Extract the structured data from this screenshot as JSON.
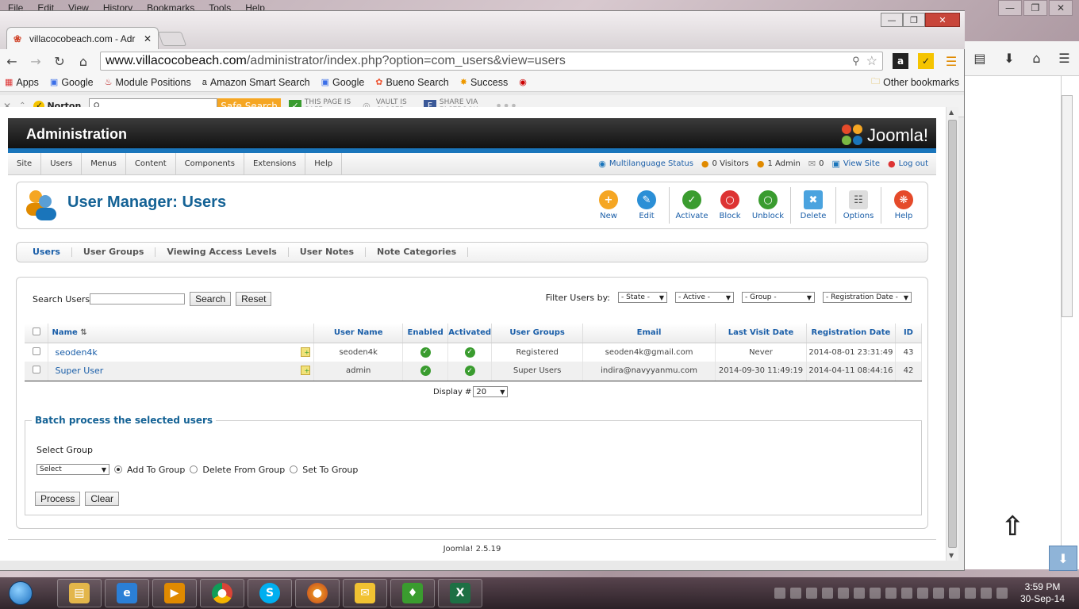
{
  "firefox": {
    "menu": [
      "File",
      "Edit",
      "View",
      "History",
      "Bookmarks",
      "Tools",
      "Help"
    ]
  },
  "chrome": {
    "tab_title": "villacocobeach.com - Adr",
    "url_host": "www.villacocobeach.com",
    "url_path": "/administrator/index.php?option=com_users&view=users",
    "bookmarks": [
      "Apps",
      "Google",
      "Module Positions",
      "Amazon Smart Search",
      "Google",
      "Bueno Search",
      "Success"
    ],
    "other_bookmarks": "Other bookmarks"
  },
  "norton": {
    "brand": "Norton",
    "safe_search": "Safe Search",
    "page_safe": "THIS PAGE IS SAFE",
    "vault": "VAULT IS CLOSED",
    "share": "SHARE VIA FACEBOOK"
  },
  "admin": {
    "header_title": "Administration",
    "logo_text": "Joomla!",
    "menu": [
      "Site",
      "Users",
      "Menus",
      "Content",
      "Components",
      "Extensions",
      "Help"
    ],
    "status": {
      "multilang": "Multilanguage Status",
      "visitors": "0 Visitors",
      "admins": "1 Admin",
      "messages": "0",
      "view_site": "View Site",
      "logout": "Log out"
    },
    "page_title": "User Manager: Users",
    "toolbar": [
      "New",
      "Edit",
      "Activate",
      "Block",
      "Unblock",
      "Delete",
      "Options",
      "Help"
    ],
    "subnav": [
      "Users",
      "User Groups",
      "Viewing Access Levels",
      "User Notes",
      "Note Categories"
    ],
    "search_label": "Search Users",
    "search_button": "Search",
    "reset_button": "Reset",
    "filter_label": "Filter Users by:",
    "filters": [
      "- State -",
      "- Active -",
      "- Group -",
      "- Registration Date -"
    ],
    "columns": [
      "Name",
      "User Name",
      "Enabled",
      "Activated",
      "User Groups",
      "Email",
      "Last Visit Date",
      "Registration Date",
      "ID"
    ],
    "rows": [
      {
        "name": "seoden4k",
        "username": "seoden4k",
        "groups": "Registered",
        "email": "seoden4k@gmail.com",
        "last_visit": "Never",
        "registered": "2014-08-01 23:31:49",
        "id": "43"
      },
      {
        "name": "Super User",
        "username": "admin",
        "groups": "Super Users",
        "email": "indira@navyyanmu.com",
        "last_visit": "2014-09-30 11:49:19",
        "registered": "2014-04-11 08:44:16",
        "id": "42"
      }
    ],
    "display_label": "Display #",
    "display_value": "20",
    "batch_title": "Batch process the selected users",
    "select_group_label": "Select Group",
    "select_value": "Select",
    "radio_options": [
      "Add To Group",
      "Delete From Group",
      "Set To Group"
    ],
    "process_button": "Process",
    "clear_button": "Clear",
    "footer": "Joomla! 2.5.19"
  },
  "taskbar": {
    "time": "3:59 PM",
    "date": "30-Sep-14"
  },
  "colors": {
    "joomla_blue": "#146295",
    "link_blue": "#1a5ea8",
    "header_bar": "#1a75bb",
    "ok_green": "#3a9c2f"
  }
}
